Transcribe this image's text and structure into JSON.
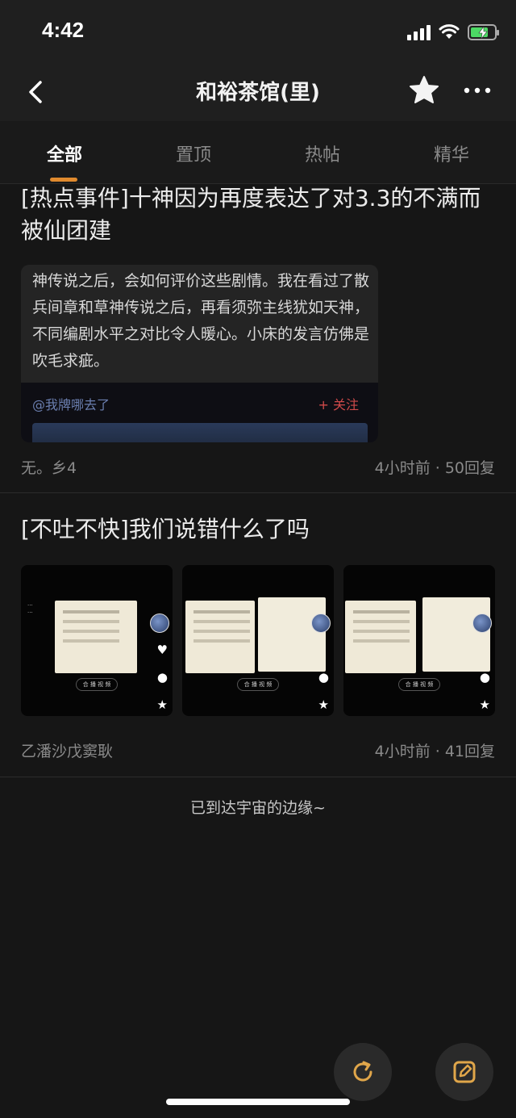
{
  "status": {
    "time": "4:42",
    "icons": [
      "signal-icon",
      "wifi-icon",
      "battery-charging-icon"
    ],
    "battery_level": 0.75
  },
  "nav": {
    "title": "和裕茶馆(里)",
    "icons": [
      "back-icon",
      "star-icon",
      "more-icon"
    ]
  },
  "tabs": [
    {
      "label": "全部",
      "active": true
    },
    {
      "label": "置顶",
      "active": false
    },
    {
      "label": "热帖",
      "active": false
    },
    {
      "label": "精华",
      "active": false
    }
  ],
  "posts": [
    {
      "title": "[热点事件]十神因为再度表达了对3.3的不满而被仙团建",
      "preview_text": "神传说之后，会如何评价这些剧情。我在看过了散兵间章和草神传说之后，再看须弥主线犹如天神，不同编剧水平之对比令人暖心。小床的发言仿佛是吹毛求疵。",
      "preview_user": "@我牌哪去了",
      "preview_follow": "+ 关注",
      "author": "无。乡4",
      "meta": "4小时前 · 50回复"
    },
    {
      "title": "[不吐不快]我们说错什么了吗",
      "thumb_button": "合 播 视 频",
      "author": "乙潘沙戊窦耿",
      "meta": "4小时前 · 41回复"
    }
  ],
  "footer": {
    "end_text": "已到达宇宙的边缘~"
  },
  "fabs": [
    "refresh-icon",
    "edit-icon"
  ],
  "colors": {
    "accent": "#e08a2e",
    "background": "#161616",
    "header": "#1f1f1f"
  }
}
